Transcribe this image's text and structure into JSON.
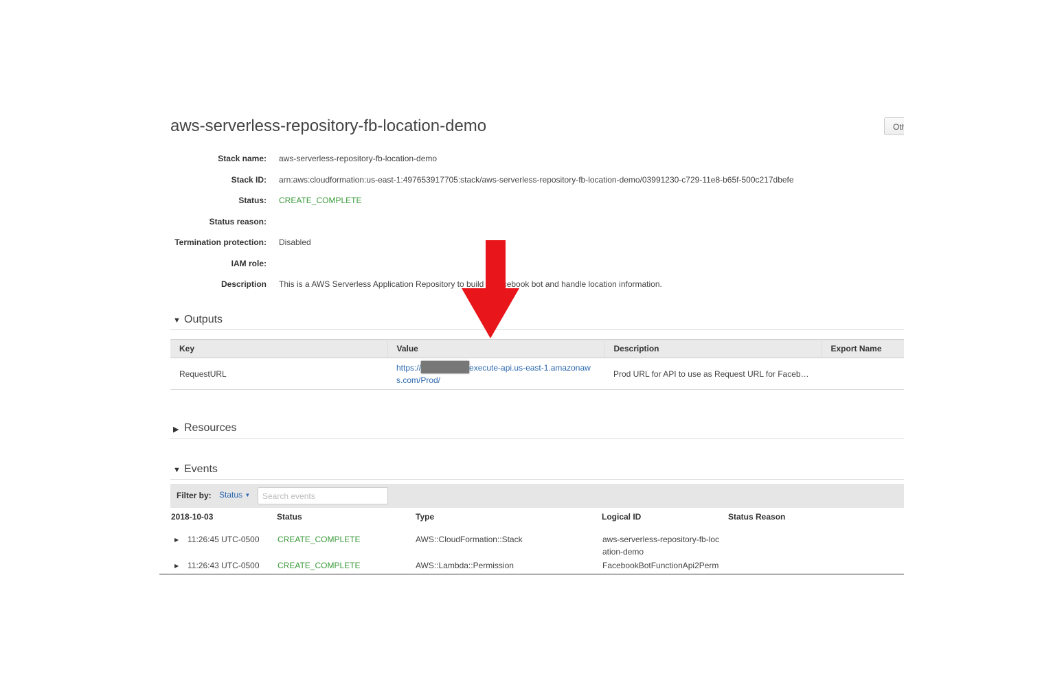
{
  "page": {
    "title": "aws-serverless-repository-fb-location-demo",
    "other_button": "Other Actions"
  },
  "overview": {
    "stack_name_label": "Stack name:",
    "stack_name": "aws-serverless-repository-fb-location-demo",
    "stack_id_label": "Stack ID:",
    "stack_id": "arn:aws:cloudformation:us-east-1:497653917705:stack/aws-serverless-repository-fb-location-demo/03991230-c729-11e8-b65f-500c217dbefe",
    "status_label": "Status:",
    "status": "CREATE_COMPLETE",
    "status_reason_label": "Status reason:",
    "status_reason": "",
    "termination_label": "Termination protection:",
    "termination": "Disabled",
    "iam_role_label": "IAM role:",
    "iam_role": "",
    "description_label": "Description",
    "description": "This is a AWS Serverless Application Repository to build a Facebook bot and handle location information."
  },
  "outputs": {
    "section_label": "Outputs",
    "headers": {
      "key": "Key",
      "value": "Value",
      "description": "Description",
      "export": "Export Name"
    },
    "row": {
      "key": "RequestURL",
      "value_prefix": "https://",
      "value_suffix_1": "execute-api.us-east-1.amazonaw",
      "value_suffix_2": "s.com/Prod/",
      "description": "Prod URL for API to use as Request URL for Faceb…",
      "export": ""
    }
  },
  "resources": {
    "section_label": "Resources"
  },
  "events": {
    "section_label": "Events",
    "filter_label": "Filter by:",
    "filter_dropdown": "Status",
    "search_placeholder": "Search events",
    "headers": {
      "date": "2018-10-03",
      "status": "Status",
      "type": "Type",
      "logical_id": "Logical ID",
      "reason": "Status Reason"
    },
    "rows": [
      {
        "time": "11:26:45 UTC-0500",
        "status": "CREATE_COMPLETE",
        "type": "AWS::CloudFormation::Stack",
        "logical_id_1": "aws-serverless-repository-fb-loc",
        "logical_id_2": "ation-demo"
      },
      {
        "time": "11:26:43 UTC-0500",
        "status": "CREATE_COMPLETE",
        "type": "AWS::Lambda::Permission",
        "logical_id_1": "FacebookBotFunctionApi2Perm",
        "logical_id_2": ""
      }
    ]
  },
  "colors": {
    "status_green": "#3a9a3a",
    "link_blue": "#2e6ab0",
    "annotation_arrow": "#e8151b"
  }
}
